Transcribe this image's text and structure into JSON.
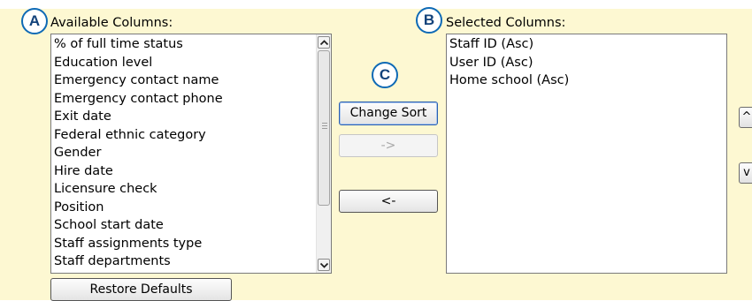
{
  "callouts": {
    "a": "A",
    "b": "B",
    "c": "C"
  },
  "available": {
    "label": "Available Columns:",
    "items": [
      "% of full time status",
      "Education level",
      "Emergency contact name",
      "Emergency contact phone",
      "Exit date",
      "Federal ethnic category",
      "Gender",
      "Hire date",
      "Licensure check",
      "Position",
      "School start date",
      "Staff assignments type",
      "Staff departments"
    ]
  },
  "selected": {
    "label": "Selected Columns:",
    "items": [
      "Staff ID (Asc)",
      "User ID (Asc)",
      "Home school (Asc)"
    ]
  },
  "buttons": {
    "change_sort": "Change Sort",
    "add": "->",
    "remove": "<-",
    "restore": "Restore Defaults",
    "move_up": "^",
    "move_down": "v"
  },
  "icons": {
    "scroll_up": "chevron-up-icon",
    "scroll_down": "chevron-down-icon",
    "scroll_grip": "grip-icon"
  },
  "colors": {
    "panel_bg": "#fdf8d2",
    "callout_ring": "#0e6ab5",
    "callout_text": "#12427a"
  }
}
